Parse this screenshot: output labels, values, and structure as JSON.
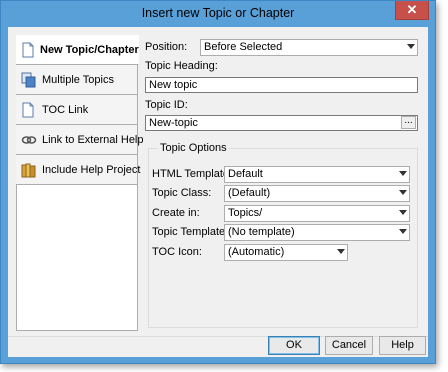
{
  "window": {
    "title": "Insert new Topic or Chapter",
    "close_glyph": "✕"
  },
  "tabs": [
    {
      "label": "New Topic/Chapter",
      "accel": "N",
      "icon": "new-page-icon",
      "active": true
    },
    {
      "label": "Multiple Topics",
      "accel": "M",
      "icon": "multiple-pages-icon",
      "active": false
    },
    {
      "label": "TOC Link",
      "accel": "T",
      "icon": "toc-link-page-icon",
      "active": false
    },
    {
      "label": "Link to External Help",
      "accel": "E",
      "icon": "external-link-icon",
      "active": false
    },
    {
      "label": "Include Help Project",
      "accel": "I",
      "icon": "help-project-icon",
      "active": false
    }
  ],
  "position": {
    "label": "Position:",
    "value": "Before Selected"
  },
  "topic_heading": {
    "label": "Topic Heading:",
    "value": "New topic"
  },
  "topic_id": {
    "label": "Topic ID:",
    "value": "New-topic",
    "browse": "..."
  },
  "options": {
    "title": "Topic Options",
    "html_template": {
      "label": "HTML Template:",
      "value": "Default"
    },
    "topic_class": {
      "label": "Topic Class:",
      "value": "(Default)"
    },
    "create_in": {
      "label": "Create in:",
      "value": "Topics/"
    },
    "topic_template": {
      "label": "Topic Template:",
      "value": "(No template)"
    },
    "toc_icon": {
      "label": "TOC Icon:",
      "value": "(Automatic)"
    }
  },
  "buttons": {
    "ok": "OK",
    "cancel": "Cancel",
    "help": "Help"
  }
}
